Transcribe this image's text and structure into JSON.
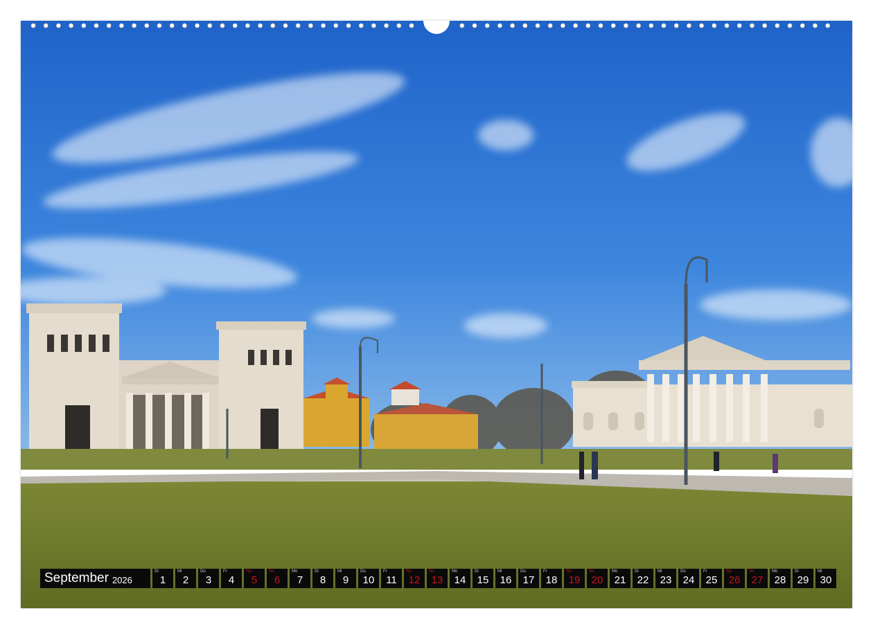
{
  "calendar": {
    "month": "September",
    "year": "2026",
    "days": [
      {
        "wd": "Di",
        "d": "1",
        "we": false
      },
      {
        "wd": "Mi",
        "d": "2",
        "we": false
      },
      {
        "wd": "Do",
        "d": "3",
        "we": false
      },
      {
        "wd": "Fr",
        "d": "4",
        "we": false
      },
      {
        "wd": "Sa",
        "d": "5",
        "we": true
      },
      {
        "wd": "So",
        "d": "6",
        "we": true
      },
      {
        "wd": "Mo",
        "d": "7",
        "we": false
      },
      {
        "wd": "Di",
        "d": "8",
        "we": false
      },
      {
        "wd": "Mi",
        "d": "9",
        "we": false
      },
      {
        "wd": "Do",
        "d": "10",
        "we": false
      },
      {
        "wd": "Fr",
        "d": "11",
        "we": false
      },
      {
        "wd": "Sa",
        "d": "12",
        "we": true
      },
      {
        "wd": "So",
        "d": "13",
        "we": true
      },
      {
        "wd": "Mo",
        "d": "14",
        "we": false
      },
      {
        "wd": "Di",
        "d": "15",
        "we": false
      },
      {
        "wd": "Mi",
        "d": "16",
        "we": false
      },
      {
        "wd": "Do",
        "d": "17",
        "we": false
      },
      {
        "wd": "Fr",
        "d": "18",
        "we": false
      },
      {
        "wd": "Sa",
        "d": "19",
        "we": true
      },
      {
        "wd": "So",
        "d": "20",
        "we": true
      },
      {
        "wd": "Mo",
        "d": "21",
        "we": false
      },
      {
        "wd": "Di",
        "d": "22",
        "we": false
      },
      {
        "wd": "Mi",
        "d": "23",
        "we": false
      },
      {
        "wd": "Do",
        "d": "24",
        "we": false
      },
      {
        "wd": "Fr",
        "d": "25",
        "we": false
      },
      {
        "wd": "Sa",
        "d": "26",
        "we": true
      },
      {
        "wd": "So",
        "d": "27",
        "we": true
      },
      {
        "wd": "Mo",
        "d": "28",
        "we": false
      },
      {
        "wd": "Di",
        "d": "29",
        "we": false
      },
      {
        "wd": "Mi",
        "d": "30",
        "we": false
      }
    ]
  },
  "colors": {
    "sky": "#2f78d8",
    "grass": "#6e7a2c",
    "bar": "#0a0a0a",
    "weekend": "#c8141e"
  }
}
